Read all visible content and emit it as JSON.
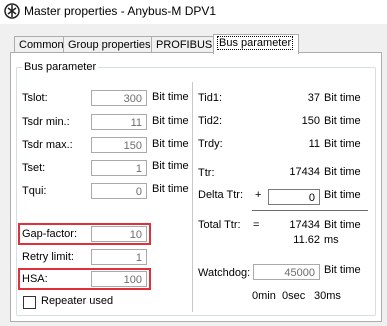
{
  "window": {
    "title": "Master properties - Anybus-M DPV1"
  },
  "tabs": [
    {
      "label": "Common",
      "active": false
    },
    {
      "label": "Group properties",
      "active": false
    },
    {
      "label": "PROFIBUS",
      "active": false
    },
    {
      "label": "Bus parameter",
      "active": true
    }
  ],
  "group_title": "Bus parameter",
  "left": {
    "tslot": {
      "label": "Tslot:",
      "value": "300",
      "unit": "Bit time"
    },
    "tsdr_min": {
      "label": "Tsdr min.:",
      "value": "11",
      "unit": "Bit time"
    },
    "tsdr_max": {
      "label": "Tsdr max.:",
      "value": "150",
      "unit": "Bit time"
    },
    "tset": {
      "label": "Tset:",
      "value": "1",
      "unit": "Bit time"
    },
    "tqui": {
      "label": "Tqui:",
      "value": "0",
      "unit": "Bit time"
    },
    "gap_factor": {
      "label": "Gap-factor:",
      "value": "10"
    },
    "retry_limit": {
      "label": "Retry limit:",
      "value": "1"
    },
    "hsa": {
      "label": "HSA:",
      "value": "100"
    },
    "repeater": {
      "label": "Repeater used",
      "checked": false
    }
  },
  "right": {
    "tid1": {
      "label": "Tid1:",
      "value": "37",
      "unit": "Bit time"
    },
    "tid2": {
      "label": "Tid2:",
      "value": "150",
      "unit": "Bit time"
    },
    "trdy": {
      "label": "Trdy:",
      "value": "11",
      "unit": "Bit time"
    },
    "ttr": {
      "label": "Ttr:",
      "value": "17434",
      "unit": "Bit time"
    },
    "delta_ttr": {
      "label": "Delta Ttr:",
      "sign": "+",
      "value": "0",
      "unit": "Bit time"
    },
    "total_ttr": {
      "label": "Total Ttr:",
      "eq": "=",
      "value": "17434",
      "unit": "Bit time",
      "ms_value": "11.62",
      "ms_unit": "ms"
    },
    "watchdog": {
      "label": "Watchdog:",
      "value": "45000",
      "unit": "Bit time",
      "min": "0min",
      "sec": "0sec",
      "ms": "30ms"
    }
  },
  "colors": {
    "highlight": "#e0303a"
  }
}
